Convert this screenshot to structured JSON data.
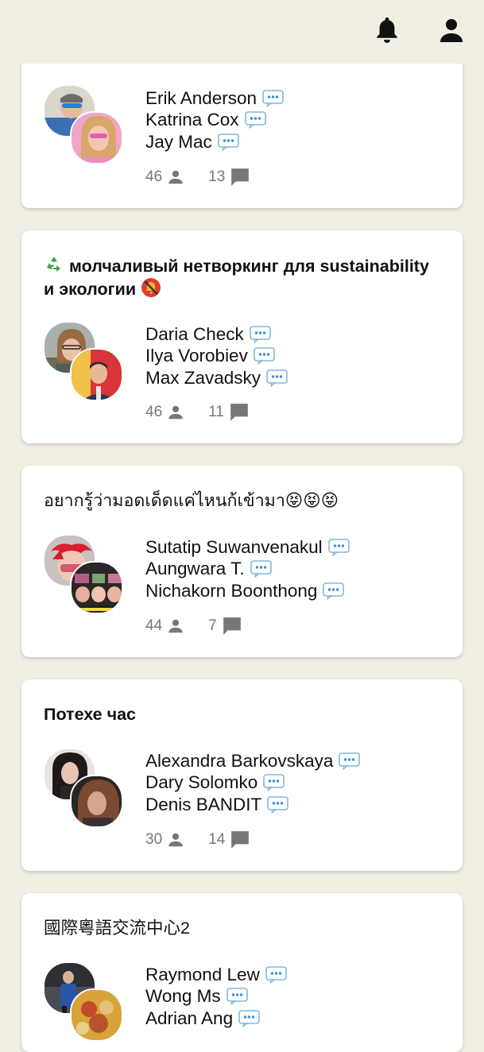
{
  "colors": {
    "background": "#f1eee4",
    "card": "#ffffff",
    "meta": "#777777",
    "bubble": "#6db3e0"
  },
  "header": {
    "icons": [
      "bell-icon",
      "user-icon"
    ]
  },
  "cards": [
    {
      "title": "",
      "members": [
        {
          "name": "Erik Anderson"
        },
        {
          "name": "Katrina Cox"
        },
        {
          "name": "Jay Mac"
        }
      ],
      "member_count": "46",
      "message_count": "13"
    },
    {
      "title_prefix_emoji": "recycle",
      "title": "молчаливый нетворкинг для sustainability и экологии",
      "title_suffix_emoji": "no-bell",
      "members": [
        {
          "name": "Daria Check"
        },
        {
          "name": "Ilya Vorobiev"
        },
        {
          "name": "Max Zavadsky"
        }
      ],
      "member_count": "46",
      "message_count": "11"
    },
    {
      "title": "อยากรู้ว่ามอดเด็ดแค่ไหนก้เข้ามา😝😝😝",
      "members": [
        {
          "name": "Sutatip Suwanvenakul"
        },
        {
          "name": "Aungwara T."
        },
        {
          "name": "Nichakorn Boonthong"
        }
      ],
      "member_count": "44",
      "message_count": "7"
    },
    {
      "title": "Потехе час",
      "members": [
        {
          "name": "Alexandra Barkovskaya"
        },
        {
          "name": "Dary Solomko"
        },
        {
          "name": "Denis BANDIT"
        }
      ],
      "member_count": "30",
      "message_count": "14"
    },
    {
      "title": "國際粵語交流中心2",
      "members": [
        {
          "name": "Raymond Lew"
        },
        {
          "name": "Wong Ms"
        },
        {
          "name": "Adrian Ang"
        }
      ],
      "member_count": "",
      "message_count": ""
    }
  ]
}
